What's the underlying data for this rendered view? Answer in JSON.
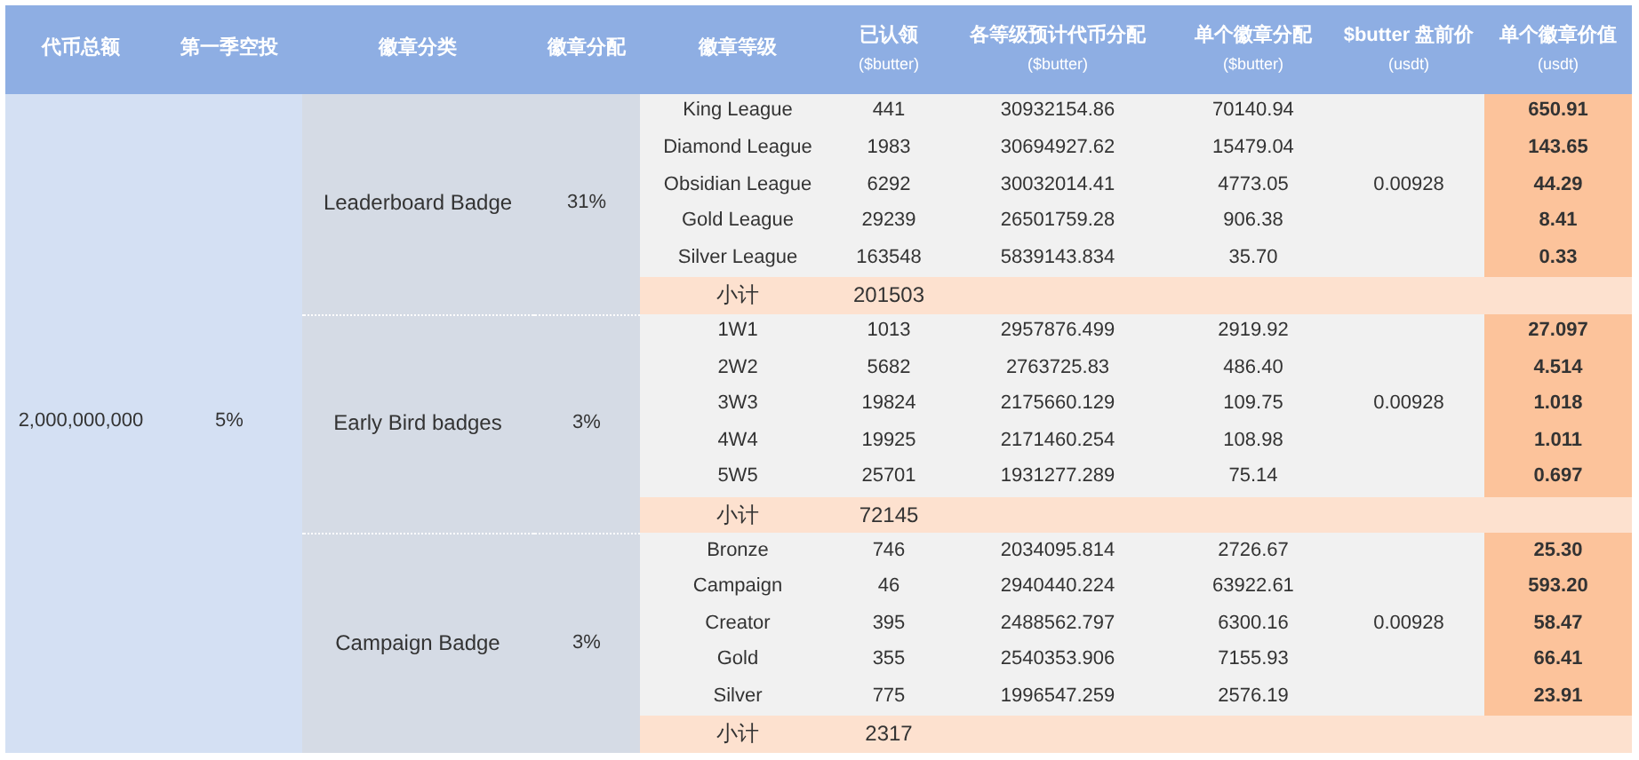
{
  "columns": [
    {
      "label": "代币总额"
    },
    {
      "label": "第一季空投"
    },
    {
      "label": "徽章分类"
    },
    {
      "label": "徽章分配"
    },
    {
      "label": "徽章等级"
    },
    {
      "label": "已认领",
      "unit": "($butter)"
    },
    {
      "label": "各等级预计代币分配",
      "unit": "($butter)"
    },
    {
      "label": "单个徽章分配",
      "unit": "($butter)"
    },
    {
      "label": "$butter 盘前价",
      "unit": "(usdt)"
    },
    {
      "label": "单个徽章价值",
      "unit": "(usdt)"
    }
  ],
  "total": "2,000,000,000",
  "airdrop": "5%",
  "categories": [
    {
      "name": "Leaderboard Badge",
      "share": "31%",
      "price": "0.00928",
      "subtotal_label": "小计",
      "subtotal": "201503",
      "levels": [
        {
          "name": "King League",
          "claimed": "441",
          "pool": "30932154.86",
          "per_badge": "70140.94",
          "value": "650.91"
        },
        {
          "name": "Diamond League",
          "claimed": "1983",
          "pool": "30694927.62",
          "per_badge": "15479.04",
          "value": "143.65"
        },
        {
          "name": "Obsidian League",
          "claimed": "6292",
          "pool": "30032014.41",
          "per_badge": "4773.05",
          "value": "44.29"
        },
        {
          "name": "Gold League",
          "claimed": "29239",
          "pool": "26501759.28",
          "per_badge": "906.38",
          "value": "8.41"
        },
        {
          "name": "Silver League",
          "claimed": "163548",
          "pool": "5839143.834",
          "per_badge": "35.70",
          "value": "0.33"
        }
      ]
    },
    {
      "name": "Early Bird badges",
      "share": "3%",
      "price": "0.00928",
      "subtotal_label": "小计",
      "subtotal": "72145",
      "levels": [
        {
          "name": "1W1",
          "claimed": "1013",
          "pool": "2957876.499",
          "per_badge": "2919.92",
          "value": "27.097"
        },
        {
          "name": "2W2",
          "claimed": "5682",
          "pool": "2763725.83",
          "per_badge": "486.40",
          "value": "4.514"
        },
        {
          "name": "3W3",
          "claimed": "19824",
          "pool": "2175660.129",
          "per_badge": "109.75",
          "value": "1.018"
        },
        {
          "name": "4W4",
          "claimed": "19925",
          "pool": "2171460.254",
          "per_badge": "108.98",
          "value": "1.011"
        },
        {
          "name": "5W5",
          "claimed": "25701",
          "pool": "1931277.289",
          "per_badge": "75.14",
          "value": "0.697"
        }
      ]
    },
    {
      "name": "Campaign Badge",
      "share": "3%",
      "price": "0.00928",
      "subtotal_label": "小计",
      "subtotal": "2317",
      "levels": [
        {
          "name": "Bronze",
          "claimed": "746",
          "pool": "2034095.814",
          "per_badge": "2726.67",
          "value": "25.30"
        },
        {
          "name": "Campaign",
          "claimed": "46",
          "pool": "2940440.224",
          "per_badge": "63922.61",
          "value": "593.20"
        },
        {
          "name": "Creator",
          "claimed": "395",
          "pool": "2488562.797",
          "per_badge": "6300.16",
          "value": "58.47"
        },
        {
          "name": "Gold",
          "claimed": "355",
          "pool": "2540353.906",
          "per_badge": "7155.93",
          "value": "66.41"
        },
        {
          "name": "Silver",
          "claimed": "775",
          "pool": "1996547.259",
          "per_badge": "2576.19",
          "value": "23.91"
        }
      ]
    }
  ]
}
